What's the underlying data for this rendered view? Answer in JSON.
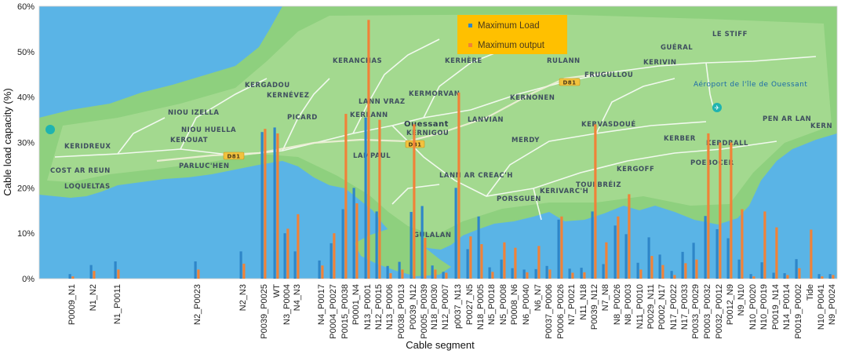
{
  "chart_data": {
    "type": "bar",
    "xlabel": "Cable segment",
    "ylabel": "Cable load capacity (%)",
    "ylim": [
      0,
      60
    ],
    "yticks": [
      "0%",
      "10%",
      "20%",
      "30%",
      "40%",
      "50%",
      "60%"
    ],
    "legend": {
      "placement": "top-center",
      "entries": [
        "Maximum Load",
        "Maximum output"
      ]
    },
    "background": "map",
    "map_labels": [
      "KERANCHAS",
      "KERHÈRE",
      "RULANN",
      "FRUGULLOU",
      "KERIVIN",
      "GUÉRAL",
      "LE STIFF",
      "KERGADOU",
      "KERNÉVEZ",
      "NIOU IZELLA",
      "NIOU HUELLA",
      "KEROUAT",
      "PICARD",
      "KERLANN",
      "LANN VRAZ",
      "KERMORVAN",
      "KERNONEN",
      "KERVASDOUÉ",
      "KERBER",
      "KERDRALL",
      "PEN AR LAN",
      "KERN",
      "KERIDREUX",
      "COST AR REUN",
      "LOQUELTAS",
      "PARLUC'HEN",
      "LAMPAUL",
      "Ouessant",
      "KERNIGOU",
      "LANVIAN",
      "MERDY",
      "LANN AR CREAC'H",
      "TOULBRÉIZ",
      "KERGOFF",
      "POEBOCER",
      "KERIVARC'H",
      "PORSGUEN",
      "GULALAN",
      "Aéroport de l'île de Ouessant",
      "D81"
    ],
    "series": [
      {
        "name": "Maximum Load",
        "color": "#2e86c8",
        "values": [
          1,
          3,
          3.8,
          3.8,
          6,
          32.3,
          33.3,
          10,
          6,
          4,
          7.8,
          15.3,
          20,
          14.8,
          35.5,
          15,
          2.8,
          3.7,
          14.7,
          16,
          2.9,
          1.5,
          20,
          6.5,
          13.7,
          2.5,
          4.2,
          2.3,
          2,
          2.1,
          2.8,
          13,
          2.2,
          2.4,
          14.8,
          3.2,
          11.7,
          9.8,
          3.5,
          9.1,
          5.3,
          1.7,
          5.9,
          7.9,
          13.8,
          10.9,
          8.9,
          4.2,
          1,
          3.6,
          1.3,
          1.2,
          4.3,
          1,
          1
        ]
      },
      {
        "name": "Maximum output",
        "color": "#f08238",
        "values": [
          0.5,
          1.7,
          2,
          2,
          3.3,
          33,
          32,
          11,
          14.2,
          2.9,
          10,
          36.3,
          16.6,
          57,
          35,
          1.2,
          2,
          14.5,
          34,
          9,
          2,
          1.3,
          41,
          9.3,
          7.6,
          1.5,
          8,
          6.8,
          1.4,
          7.2,
          2,
          13.7,
          1.3,
          1.4,
          34,
          8,
          13.7,
          18.6,
          2,
          5,
          3,
          0.8,
          3.4,
          4.2,
          32,
          30,
          30,
          15.3,
          0.5,
          14.8,
          11.3,
          0.8,
          2.3,
          10.8,
          0.5,
          0.8
        ]
      }
    ],
    "x_positions": [
      {
        "label": "P0009_N1",
        "show_label": true,
        "load": 1.0,
        "output": 0.5
      },
      {
        "label": "N1_N2",
        "show_label": true,
        "load": 3.0,
        "output": 1.7
      },
      {
        "label": "N1_P0011",
        "show_label": true,
        "load": 3.8,
        "output": 2.0
      },
      {
        "label": "N2_P0023",
        "show_label": true,
        "load": 3.8,
        "output": 2.0
      },
      {
        "label": "N2_N3",
        "show_label": true,
        "load": 6.0,
        "output": 3.3
      },
      {
        "label": "P0039_P0025",
        "show_label": true,
        "load": 32.3,
        "output": 33.0
      },
      {
        "label": "WT",
        "show_label": true,
        "load": 33.3,
        "output": 32.0
      },
      {
        "label": "N3_P0004",
        "show_label": true,
        "load": 10.0,
        "output": 11.0
      },
      {
        "label": "N4_N3",
        "show_label": true,
        "load": 6.0,
        "output": 14.2
      },
      {
        "label": "",
        "show_label": false,
        "load": null,
        "output": null
      },
      {
        "label": "N4_P0017",
        "show_label": true,
        "load": 4.0,
        "output": 2.9
      },
      {
        "label": "P0004_P0027",
        "show_label": true,
        "load": 7.8,
        "output": 10.0
      },
      {
        "label": "P0015_P0038",
        "show_label": true,
        "load": 15.3,
        "output": 36.3
      },
      {
        "label": "P0001_N4",
        "show_label": true,
        "load": 20.0,
        "output": 16.6
      },
      {
        "label": "N13_P0001",
        "show_label": true,
        "load": 35.5,
        "output": 57.0
      },
      {
        "label": "N12_P0015",
        "show_label": true,
        "load": 14.8,
        "output": 35.0
      },
      {
        "label": "N13_P0006",
        "show_label": true,
        "load": 2.8,
        "output": 1.2
      },
      {
        "label": "P0038_P0013",
        "show_label": true,
        "load": 3.7,
        "output": 2.0
      },
      {
        "label": "P0039_N12",
        "show_label": true,
        "load": 14.7,
        "output": 34.0
      },
      {
        "label": "P0005_P0039",
        "show_label": true,
        "load": 16.0,
        "output": 9.0
      },
      {
        "label": "N18_P0030",
        "show_label": true,
        "load": 2.9,
        "output": 2.0
      },
      {
        "label": "N12_P0007",
        "show_label": true,
        "load": 1.5,
        "output": 1.3
      },
      {
        "label": "p0037_N13",
        "show_label": true,
        "load": 20.0,
        "output": 41.0
      },
      {
        "label": "P0027_N5",
        "show_label": true,
        "load": 6.5,
        "output": 9.3
      },
      {
        "label": "N18_P0005",
        "show_label": true,
        "load": 13.7,
        "output": 7.6
      },
      {
        "label": "N5_P0018",
        "show_label": true,
        "load": 2.5,
        "output": 1.5
      },
      {
        "label": "N5_P0008",
        "show_label": true,
        "load": 4.2,
        "output": 8.0
      },
      {
        "label": "P0008_N6",
        "show_label": true,
        "load": 2.3,
        "output": 6.8
      },
      {
        "label": "N6_P0040",
        "show_label": true,
        "load": 2.0,
        "output": 1.4
      },
      {
        "label": "N6_N7",
        "show_label": true,
        "load": 2.1,
        "output": 7.2
      },
      {
        "label": "P0037_P0006",
        "show_label": true,
        "load": 2.8,
        "output": 2.0
      },
      {
        "label": "P0006_P0026",
        "show_label": true,
        "load": 13.0,
        "output": 13.7
      },
      {
        "label": "N7_P0021",
        "show_label": true,
        "load": 2.2,
        "output": 1.3
      },
      {
        "label": "N11_N18",
        "show_label": true,
        "load": 2.4,
        "output": 1.4
      },
      {
        "label": "P0039_N12",
        "show_label": true,
        "load": 14.8,
        "output": 34.0
      },
      {
        "label": "N7_N8",
        "show_label": true,
        "load": 3.2,
        "output": 8.0
      },
      {
        "label": "N8_P0026",
        "show_label": true,
        "load": 11.7,
        "output": 13.7
      },
      {
        "label": "N8_P0003",
        "show_label": true,
        "load": 9.8,
        "output": 18.6
      },
      {
        "label": "N11_P0010",
        "show_label": true,
        "load": 3.5,
        "output": 2.0
      },
      {
        "label": "P0029_N11",
        "show_label": true,
        "load": 9.1,
        "output": 5.0
      },
      {
        "label": "P0002_N17",
        "show_label": true,
        "load": 5.3,
        "output": 3.0
      },
      {
        "label": "N17_P0022",
        "show_label": true,
        "load": 1.7,
        "output": 0.8
      },
      {
        "label": "N17_P0033",
        "show_label": true,
        "load": 5.9,
        "output": 3.4
      },
      {
        "label": "P0033_P0029",
        "show_label": true,
        "load": 7.9,
        "output": 4.2
      },
      {
        "label": "P0003_P0032",
        "show_label": true,
        "load": 13.8,
        "output": 32.0
      },
      {
        "label": "P0032_P0012",
        "show_label": true,
        "load": 10.9,
        "output": 30.0
      },
      {
        "label": "P0012_N9",
        "show_label": true,
        "load": 8.9,
        "output": 30.0
      },
      {
        "label": "N9_N10",
        "show_label": true,
        "load": 4.2,
        "output": 15.3
      },
      {
        "label": "N10_P0020",
        "show_label": true,
        "load": 1.0,
        "output": 0.5
      },
      {
        "label": "N10_P0019",
        "show_label": true,
        "load": 3.6,
        "output": 14.8
      },
      {
        "label": "P0019_N14",
        "show_label": true,
        "load": 1.3,
        "output": 11.3
      },
      {
        "label": "N14_P0014",
        "show_label": true,
        "load": 1.2,
        "output": 0.8
      },
      {
        "label": "P0019_P0002",
        "show_label": true,
        "load": 4.3,
        "output": 2.3
      },
      {
        "label": "Tide",
        "show_label": true,
        "load": null,
        "output": 10.8
      },
      {
        "label": "N10_P0041",
        "show_label": true,
        "load": 1.0,
        "output": 0.5
      },
      {
        "label": "N9_P0024",
        "show_label": true,
        "load": 1.0,
        "output": 0.8
      }
    ]
  }
}
